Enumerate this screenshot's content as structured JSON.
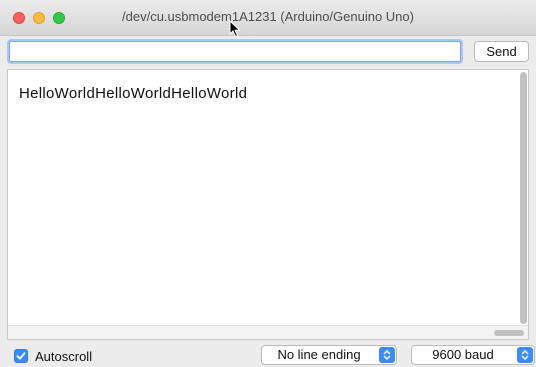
{
  "window": {
    "title": "/dev/cu.usbmodem1A1231 (Arduino/Genuino Uno)"
  },
  "toolbar": {
    "input_value": "",
    "send_label": "Send"
  },
  "output": {
    "text": "HelloWorldHelloWorldHelloWorld"
  },
  "statusbar": {
    "autoscroll_label": "Autoscroll",
    "autoscroll_checked": true,
    "line_ending_value": "No line ending",
    "baud_value": "9600 baud"
  },
  "colors": {
    "accent": "#3b8cf5",
    "close": "#fc615d",
    "minimize": "#fdbc40",
    "maximize": "#34c84a"
  }
}
